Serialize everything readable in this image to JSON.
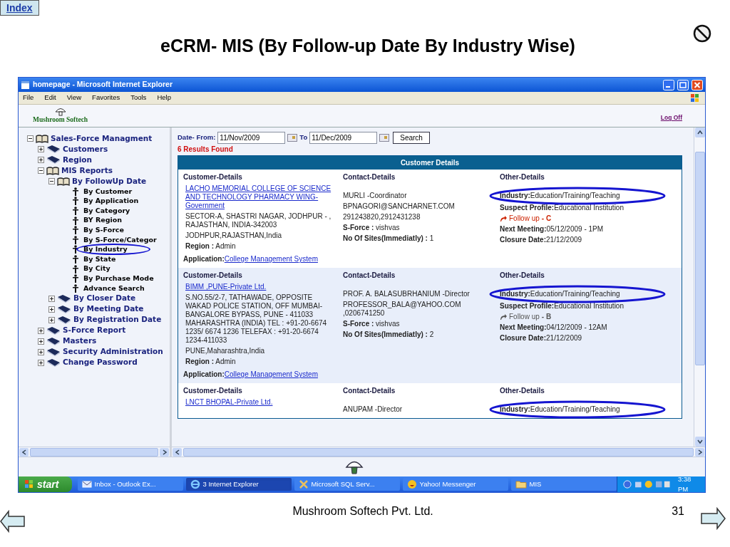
{
  "slide": {
    "index_button": "Index",
    "title": "eCRM- MIS (By Follow-up Date By Industry Wise)",
    "footer": "Mushroom Softech Pvt. Ltd.",
    "page_number": "31"
  },
  "window": {
    "title": "homepage - Microsoft Internet Explorer",
    "menu": [
      "File",
      "Edit",
      "View",
      "Favorites",
      "Tools",
      "Help"
    ]
  },
  "app": {
    "brand": "Mushroom Softech",
    "logoff": "Log Off"
  },
  "tree": [
    {
      "label": "Sales-Force Managment",
      "kind": "folder",
      "expanded": true,
      "children": [
        {
          "label": "Customers",
          "kind": "folder",
          "expanded": false
        },
        {
          "label": "Region",
          "kind": "folder",
          "expanded": false
        },
        {
          "label": "MIS Reports",
          "kind": "folder",
          "expanded": true,
          "children": [
            {
              "label": "By FollowUp Date",
              "kind": "folder",
              "expanded": true,
              "children": [
                {
                  "label": "By Customer",
                  "kind": "leaf",
                  "circled": false
                },
                {
                  "label": "By Application",
                  "kind": "leaf",
                  "circled": false
                },
                {
                  "label": "By Category",
                  "kind": "leaf",
                  "circled": false
                },
                {
                  "label": "BY Region",
                  "kind": "leaf",
                  "circled": false
                },
                {
                  "label": "By S-Force",
                  "kind": "leaf",
                  "circled": false
                },
                {
                  "label": "By S-Force/Categor",
                  "kind": "leaf",
                  "circled": false
                },
                {
                  "label": "By Industry",
                  "kind": "leaf",
                  "circled": true
                },
                {
                  "label": "By State",
                  "kind": "leaf",
                  "circled": false
                },
                {
                  "label": "By City",
                  "kind": "leaf",
                  "circled": false
                },
                {
                  "label": "By Purchase Mode",
                  "kind": "leaf",
                  "circled": false
                },
                {
                  "label": "Advance Search",
                  "kind": "leaf",
                  "circled": false
                }
              ]
            },
            {
              "label": "By Closer Date",
              "kind": "folder",
              "expanded": false
            },
            {
              "label": "By Meeting Date",
              "kind": "folder",
              "expanded": false
            },
            {
              "label": "By Registration Date",
              "kind": "folder",
              "expanded": false
            }
          ]
        },
        {
          "label": "S-Force Report",
          "kind": "folder",
          "expanded": false
        },
        {
          "label": "Masters",
          "kind": "folder",
          "expanded": false
        },
        {
          "label": "Security Administration",
          "kind": "folder",
          "expanded": false
        },
        {
          "label": "Change Password",
          "kind": "folder",
          "expanded": false
        }
      ]
    }
  ],
  "search": {
    "from_label": "Date- From:",
    "from": "11/Nov/2009",
    "to_label": "To",
    "to": "11/Dec/2009",
    "button": "Search",
    "results": "6 Results Found"
  },
  "table": {
    "title": "Customer Details",
    "records": [
      {
        "shaded": false,
        "headers": [
          "Customer-Details",
          "Contact-Details",
          "Other-Details"
        ],
        "name": "LACHO MEMORIAL COLLEGE OF SCIENCE AND TECHNOLOGY PHARMACY WING-Government",
        "address": "SECTOR-A, SHASTRI NAGAR, JODHPUR - , RAJASTHAN, INDIA-342003",
        "city": "JODHPUR,RAJASTHAN,India",
        "region": "**Region :** Admin",
        "application_label": "Application:",
        "application": "College Management System",
        "contact": [
          "MURLI -Coordinator",
          "BPNAGORI@SANCHARNET.COM",
          "291243820,2912431238"
        ],
        "sforce": "**S-Force :** vishvas",
        "sites": "**No Of Sites(Immediatly) :** 1",
        "industry": "**Industry:**Education/Training/Teaching",
        "industry_circled": true,
        "suspect": "**Suspect Profile:**Educational Institution",
        "followup": "Follow up",
        "grade": "- C",
        "color": "#cc2200",
        "meeting": "**Next Meeting:**05/12/2009 - 1PM",
        "closure": "**Closure Date:**21/12/2009"
      },
      {
        "shaded": true,
        "headers": [
          "Customer-Details",
          "Contact-Details",
          "Other-Details"
        ],
        "name": "BIMM ,PUNE-Private Ltd.",
        "address": "S.NO.55/2-7, TATHAWADE, OPPOSITE WAKAD POLICE STATION, OFF MUMBAI-BANGALORE BYPASS, PUNE - 411033 MAHARASHTRA (INDIA) TEL : +91-20-6674 1235/ 6674 1236 TELEFAX : +91-20-6674 1234-411033",
        "city": "PUNE,Maharashtra,India",
        "region": "**Region :** Admin",
        "application_label": "Application:",
        "application": "College Management System",
        "contact": [
          "PROF. A. BALASUBRHANIUM -Director",
          "PROFESSOR_BALA@YAHOO.COM ,0206741250"
        ],
        "sforce": "**S-Force :** vishvas",
        "sites": "**No Of Sites(Immediatly) :** 2",
        "industry": "**Industry:**Education/Training/Teaching",
        "industry_circled": true,
        "suspect": "**Suspect Profile:**Educational Institution",
        "followup": "Follow up",
        "grade": "- B",
        "color": "#555555",
        "meeting": "**Next Meeting:**04/12/2009 - 12AM",
        "closure": "**Closure Date:**21/12/2009"
      },
      {
        "shaded": false,
        "headers": [
          "Customer-Details",
          "Contact-Details",
          "Other-Details"
        ],
        "name": "LNCT BHOPAL-Private Ltd.",
        "contact": [
          "ANUPAM -Director"
        ],
        "industry": "**Industry:**Education/Training/Teaching",
        "industry_circled": true
      }
    ]
  },
  "taskbar": {
    "start": "start",
    "items": [
      {
        "label": "Inbox - Outlook Ex...",
        "kind": "mail",
        "selected": false
      },
      {
        "label": "3 Internet Explorer",
        "kind": "browser",
        "selected": true
      },
      {
        "label": "Microsoft SQL Serv...",
        "kind": "tools",
        "selected": false
      },
      {
        "label": "Yahoo! Messenger",
        "kind": "smiley",
        "selected": false
      },
      {
        "label": "MIS",
        "kind": "folder",
        "selected": false
      }
    ],
    "clock": "3:38 PM"
  }
}
